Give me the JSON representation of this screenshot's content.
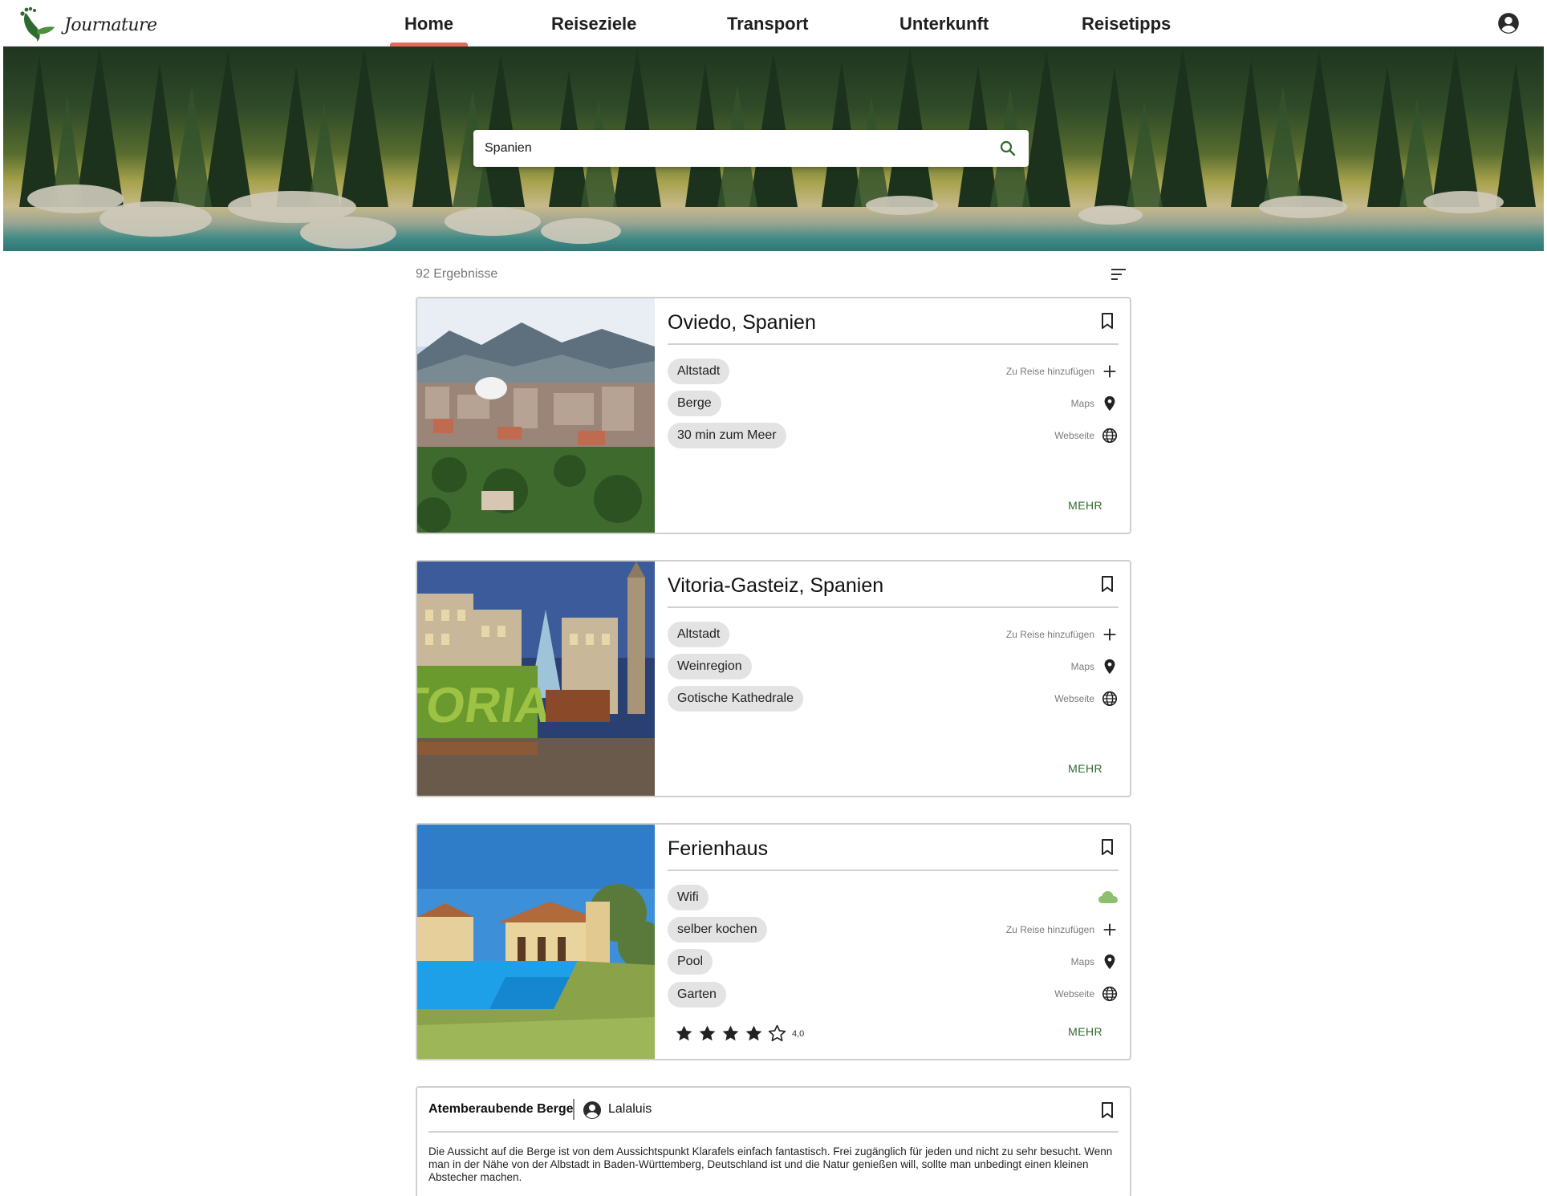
{
  "app": {
    "logo_text": "Journature"
  },
  "nav": {
    "items": [
      {
        "label": "Home",
        "active": true
      },
      {
        "label": "Reiseziele",
        "active": false
      },
      {
        "label": "Transport",
        "active": false
      },
      {
        "label": "Unterkunft",
        "active": false
      },
      {
        "label": "Reisetipps",
        "active": false
      }
    ]
  },
  "search": {
    "value": "Spanien"
  },
  "results": {
    "count_label": "92 Ergebnisse"
  },
  "cards": [
    {
      "title": "Oviedo, Spanien",
      "tags": [
        "Altstadt",
        "Berge",
        "30 min zum Meer"
      ],
      "actions": {
        "add": "Zu Reise hinzufügen",
        "maps": "Maps",
        "website": "Webseite"
      },
      "more": "MEHR"
    },
    {
      "title": "Vitoria-Gasteiz, Spanien",
      "tags": [
        "Altstadt",
        "Weinregion",
        "Gotische Kathedrale"
      ],
      "actions": {
        "add": "Zu Reise hinzufügen",
        "maps": "Maps",
        "website": "Webseite"
      },
      "more": "MEHR"
    },
    {
      "title": "Ferienhaus",
      "tags": [
        "Wifi",
        "selber kochen",
        "Pool",
        "Garten"
      ],
      "actions": {
        "add": "Zu Reise hinzufügen",
        "maps": "Maps",
        "website": "Webseite"
      },
      "rating": 4.0,
      "rating_label": "4,0",
      "rating_max": 5,
      "more": "MEHR"
    }
  ],
  "review": {
    "title": "Atemberaubende Berge",
    "user": "Lalaluis",
    "text": "Die Aussicht auf die Berge ist von dem Aussichtspunkt Klarafels einfach fantastisch. Frei zugänglich für jeden und nicht zu sehr besucht. Wenn man in der Nähe von der Albstadt in Baden-Württemberg, Deutschland ist und die Natur genießen will, sollte man unbedingt einen kleinen Abstecher machen."
  },
  "colors": {
    "accent_underline": "#e26b5e",
    "more_link": "#2e6b2e",
    "cloud": "#8cc06e",
    "chip_bg": "#e3e3e3"
  }
}
